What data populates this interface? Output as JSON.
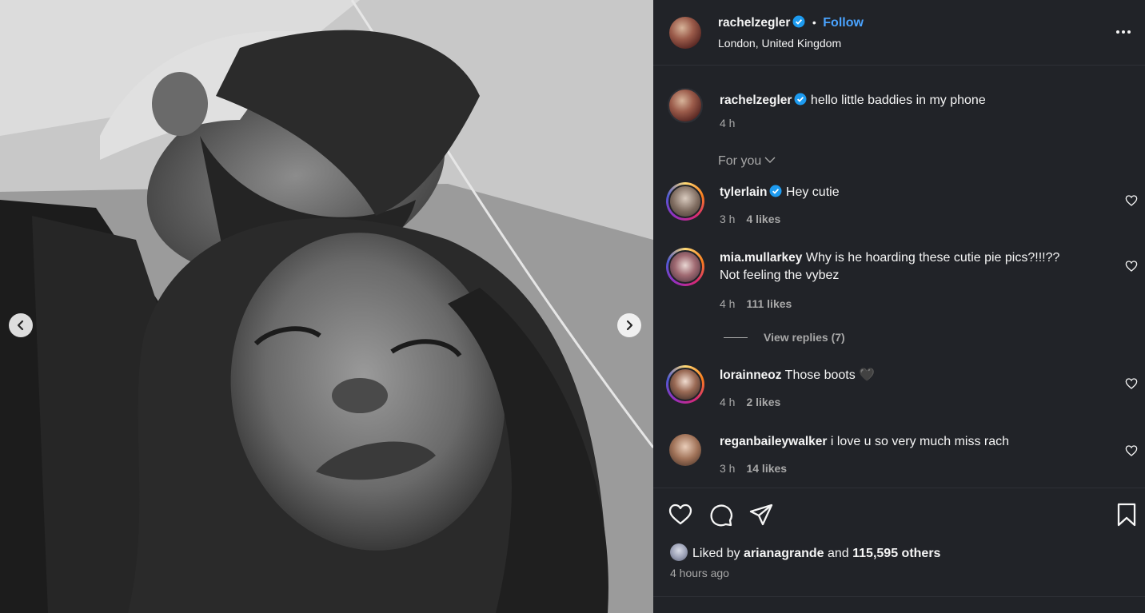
{
  "post": {
    "author": "rachelzegler",
    "location": "London, United Kingdom",
    "follow_label": "Follow",
    "separator": "•"
  },
  "caption": {
    "username": "rachelzegler",
    "text": "hello little baddies in my phone",
    "time": "4 h"
  },
  "filter": {
    "label": "For you"
  },
  "comments": [
    {
      "username": "tylerlain",
      "verified": true,
      "text": "Hey cutie",
      "time": "3 h",
      "likes": "4 likes"
    },
    {
      "username": "mia.mullarkey",
      "verified": false,
      "text": "Why is he hoarding these cutie pie pics?!!!??",
      "text2": "Not feeling the vybez",
      "time": "4 h",
      "likes": "111 likes"
    },
    {
      "username": "lorainneoz",
      "verified": false,
      "text": "Those boots 🖤",
      "time": "4 h",
      "likes": "2 likes"
    },
    {
      "username": "reganbaileywalker",
      "verified": false,
      "text": "i love u so very much miss rach",
      "time": "3 h",
      "likes": "14 likes"
    }
  ],
  "view_replies": "View replies (7)",
  "likes": {
    "prefix": "Liked by",
    "user": "arianagrande",
    "and": "and",
    "others": "115,595 others"
  },
  "posted": "4 hours ago",
  "colors": {
    "panel_bg": "#212328",
    "link_blue": "#4aa3ff",
    "muted": "#a8a8a8",
    "verified": "#1d9bf0"
  },
  "icons": [
    "more-options-icon",
    "verified-icon",
    "chevron-down-icon",
    "heart-icon",
    "comment-icon",
    "share-icon",
    "bookmark-icon",
    "arrow-left-icon",
    "arrow-right-icon"
  ]
}
